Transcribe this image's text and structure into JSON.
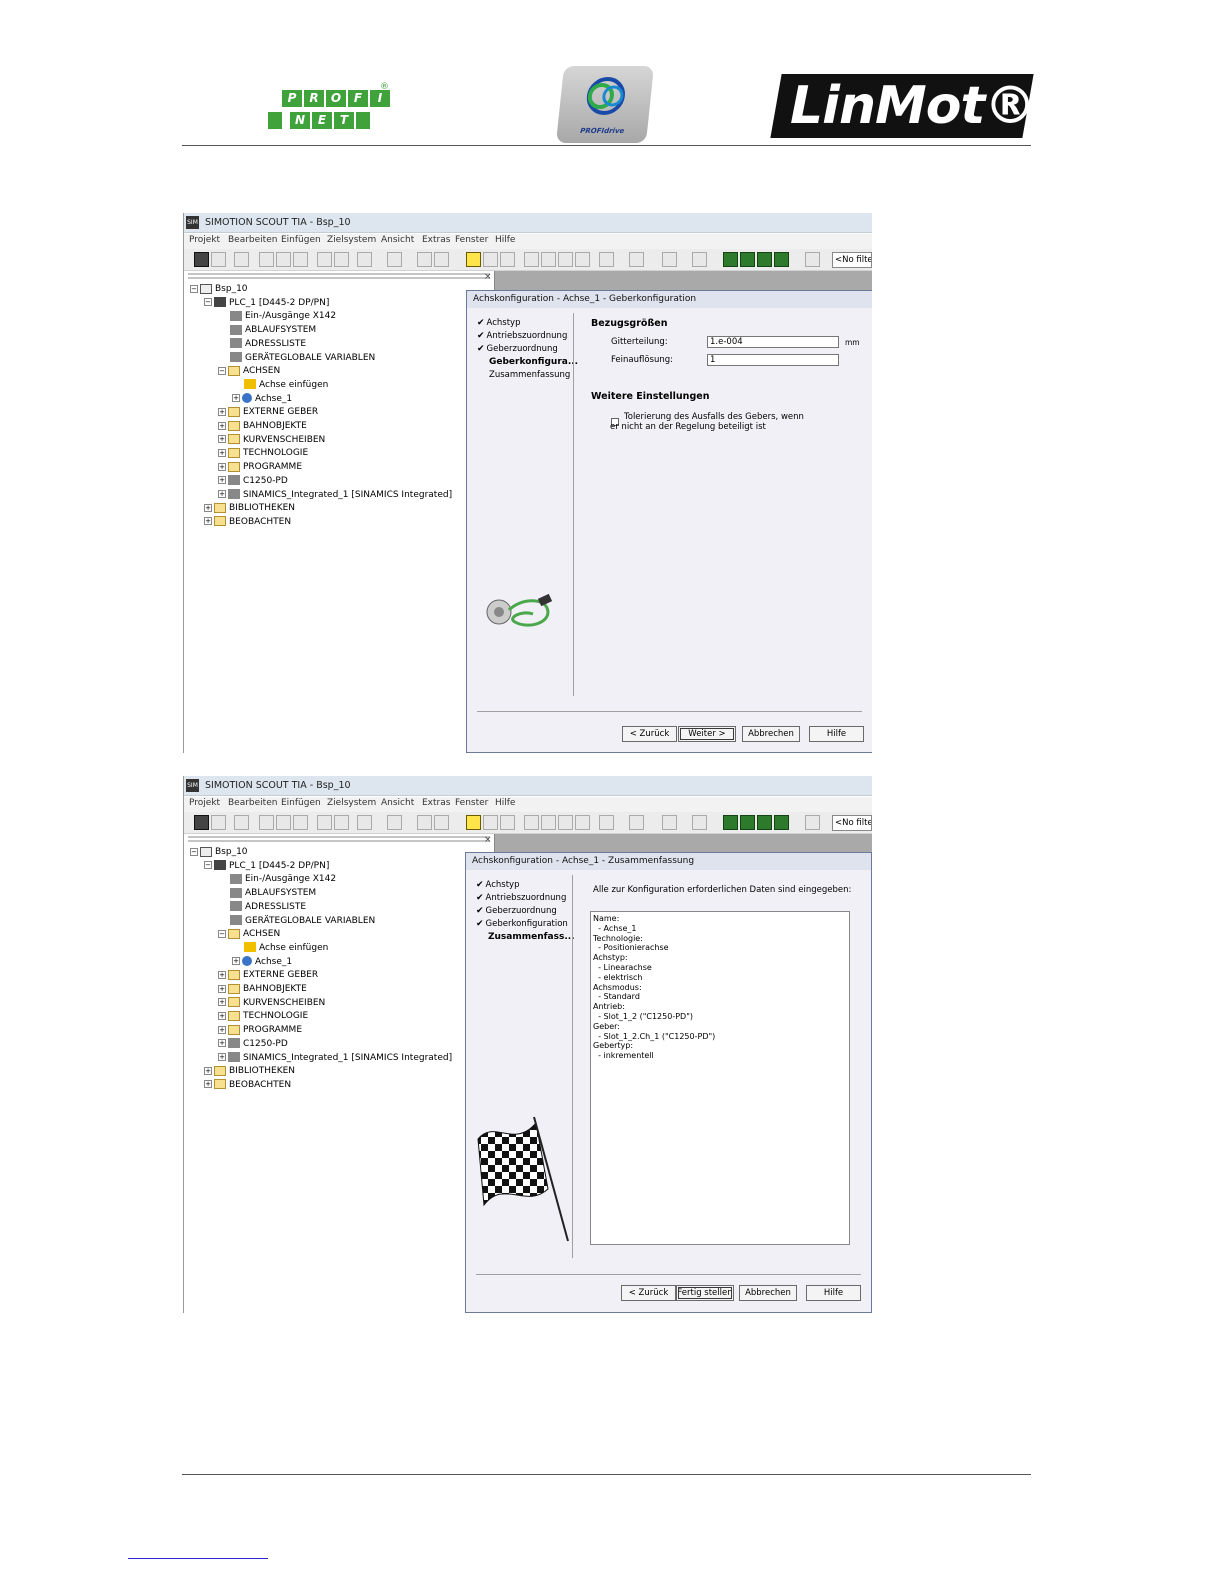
{
  "header": {
    "profinet_letters_top": [
      "P",
      "R",
      "O",
      "F",
      "I"
    ],
    "profinet_letters_bottom": [
      "N",
      "E",
      "T"
    ],
    "profinet_reg": "®",
    "profidrive_text": "PROFIdrive",
    "linmot_text": "LinMot®"
  },
  "app": {
    "title": "SIMOTION SCOUT TIA - Bsp_10",
    "icon_text": "SIM",
    "menu": [
      "Projekt",
      "Bearbeiten",
      "Einfügen",
      "Zielsystem",
      "Ansicht",
      "Extras",
      "Fenster",
      "Hilfe"
    ],
    "filter_label": "<No filter>",
    "close_pane": "×"
  },
  "tree": [
    {
      "label": "Bsp_10",
      "depth": 0,
      "expand": "−",
      "icon": "proj"
    },
    {
      "label": "PLC_1 [D445-2 DP/PN]",
      "depth": 1,
      "expand": "−",
      "icon": "plc"
    },
    {
      "label": "Ein-/Ausgänge X142",
      "depth": 2,
      "expand": "",
      "icon": "gen"
    },
    {
      "label": "ABLAUFSYSTEM",
      "depth": 2,
      "expand": "",
      "icon": "gen"
    },
    {
      "label": "ADRESSLISTE",
      "depth": 2,
      "expand": "",
      "icon": "gen"
    },
    {
      "label": "GERÄTEGLOBALE VARIABLEN",
      "depth": 2,
      "expand": "",
      "icon": "gen"
    },
    {
      "label": "ACHSEN",
      "depth": 2,
      "expand": "−",
      "icon": "folder"
    },
    {
      "label": "Achse einfügen",
      "depth": 3,
      "expand": "",
      "icon": "add"
    },
    {
      "label": "Achse_1",
      "depth": 3,
      "expand": "+",
      "icon": "axis"
    },
    {
      "label": "EXTERNE GEBER",
      "depth": 2,
      "expand": "+",
      "icon": "folder"
    },
    {
      "label": "BAHNOBJEKTE",
      "depth": 2,
      "expand": "+",
      "icon": "folder"
    },
    {
      "label": "KURVENSCHEIBEN",
      "depth": 2,
      "expand": "+",
      "icon": "folder"
    },
    {
      "label": "TECHNOLOGIE",
      "depth": 2,
      "expand": "+",
      "icon": "folder"
    },
    {
      "label": "PROGRAMME",
      "depth": 2,
      "expand": "+",
      "icon": "folder"
    },
    {
      "label": "C1250-PD",
      "depth": 2,
      "expand": "+",
      "icon": "gen"
    },
    {
      "label": "SINAMICS_Integrated_1 [SINAMICS Integrated]",
      "depth": 2,
      "expand": "+",
      "icon": "gen"
    },
    {
      "label": "BIBLIOTHEKEN",
      "depth": 1,
      "expand": "+",
      "icon": "folder"
    },
    {
      "label": "BEOBACHTEN",
      "depth": 1,
      "expand": "+",
      "icon": "folder"
    }
  ],
  "dialog1": {
    "title": "Achskonfiguration - Achse_1 - Geberkonfiguration",
    "steps_done": [
      "Achstyp",
      "Antriebszuordnung",
      "Geberzuordnung"
    ],
    "step_current": "Geberkonfigura...",
    "steps_rest": [
      "Zusammenfassung"
    ],
    "section1": "Bezugsgrößen",
    "gitter_label": "Gitterteilung:",
    "gitter_value": "1.e-004",
    "gitter_unit": "mm",
    "fein_label": "Feinauflösung:",
    "fein_value": "1",
    "section2": "Weitere Einstellungen",
    "checkbox_line1": "Tolerierung des Ausfalls des Gebers, wenn",
    "checkbox_line2": "er nicht an der Regelung beteiligt ist",
    "btn_back": "< Zurück",
    "btn_next": "Weiter >",
    "btn_cancel": "Abbrechen",
    "btn_help": "Hilfe"
  },
  "dialog2": {
    "title": "Achskonfiguration - Achse_1 - Zusammenfassung",
    "steps_done": [
      "Achstyp",
      "Antriebszuordnung",
      "Geberzuordnung",
      "Geberkonfiguration"
    ],
    "step_current": "Zusammenfass...",
    "intro": "Alle zur Konfiguration erforderlichen Daten sind eingegeben:",
    "summary": "Name:\n  - Achse_1\nTechnologie:\n  - Positionierachse\nAchstyp:\n  - Linearachse\n  - elektrisch\nAchsmodus:\n  - Standard\nAntrieb:\n  - Slot_1_2 (\"C1250-PD\")\nGeber:\n  - Slot_1_2.Ch_1 (\"C1250-PD\")\nGebertyp:\n  - inkrementell",
    "btn_back": "< Zurück",
    "btn_finish": "Fertig stellen",
    "btn_cancel": "Abbrechen",
    "btn_help": "Hilfe"
  }
}
